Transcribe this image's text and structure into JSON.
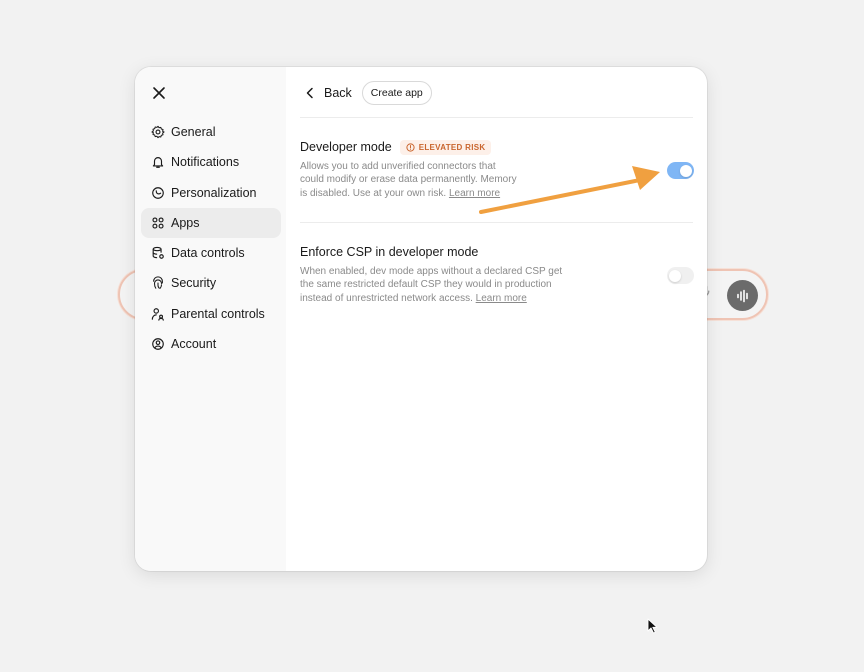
{
  "sidebar": {
    "items": [
      {
        "label": "General",
        "icon": "gear-icon"
      },
      {
        "label": "Notifications",
        "icon": "bell-icon"
      },
      {
        "label": "Personalization",
        "icon": "personalization-icon"
      },
      {
        "label": "Apps",
        "icon": "apps-grid-icon",
        "active": true
      },
      {
        "label": "Data controls",
        "icon": "database-icon"
      },
      {
        "label": "Security",
        "icon": "fingerprint-icon"
      },
      {
        "label": "Parental controls",
        "icon": "parental-icon"
      },
      {
        "label": "Account",
        "icon": "account-icon"
      }
    ]
  },
  "topbar": {
    "back_label": "Back",
    "create_app_label": "Create app"
  },
  "settings": [
    {
      "title": "Developer mode",
      "badge": "ELEVATED RISK",
      "desc_line1": "Allows you to add unverified connectors that",
      "desc_line2": "could modify or erase data permanently. Memory",
      "desc_line3": "is disabled. Use at your own risk.",
      "learn_more": "Learn more",
      "enabled": true
    },
    {
      "title": "Enforce CSP in developer mode",
      "desc_line1": "When enabled, dev mode apps without a declared CSP get",
      "desc_line2": "the same restricted default CSP they would in production",
      "desc_line3": "instead of unrestricted network access.",
      "learn_more": "Learn more",
      "enabled": false
    }
  ],
  "colors": {
    "toggle_on": "#7fb6f5",
    "toggle_off": "#f0f0f0",
    "risk_badge_text": "#c9652d",
    "risk_badge_bg": "#fdf0e9",
    "annotation_arrow": "#f0a040"
  }
}
